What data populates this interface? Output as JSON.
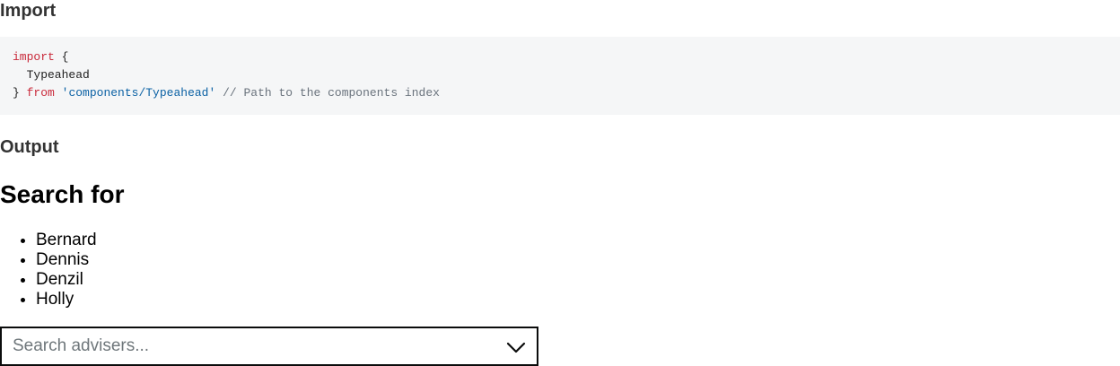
{
  "import_section": {
    "heading": "Import",
    "code": {
      "line1_keyword": "import",
      "line1_rest": " {",
      "line2": "  Typeahead",
      "line3_brace": "} ",
      "line3_keyword": "from",
      "line3_space": " ",
      "line3_string": "'components/Typeahead'",
      "line3_comment": " // Path to the components index"
    }
  },
  "output_section": {
    "heading": "Output",
    "title": "Search for",
    "items": [
      "Bernard",
      "Dennis",
      "Denzil",
      "Holly"
    ],
    "search": {
      "placeholder": "Search advisers...",
      "value": "",
      "icon": "chevron-down-icon"
    }
  },
  "colors": {
    "keyword": "#c9293a",
    "string": "#0b61a4",
    "comment": "#6a737d",
    "code_background": "#f5f6f7",
    "input_border": "#0b0c0c"
  }
}
